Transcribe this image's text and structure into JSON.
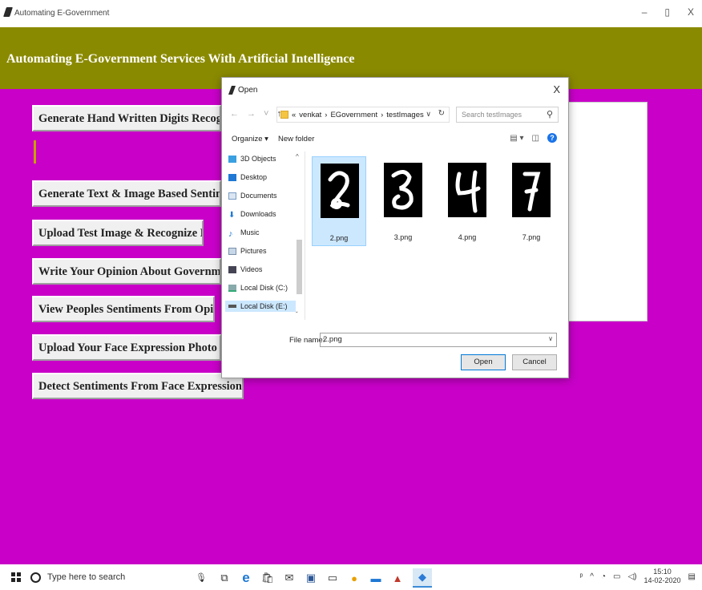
{
  "window": {
    "title": "Automating E-Government",
    "controls": {
      "minimize": "–",
      "maximize": "▯",
      "close": "X"
    }
  },
  "app": {
    "heading": "Automating E-Government Services With Artificial Intelligence",
    "buttons": [
      "Generate Hand Written Digits Recognition Deep Learning Model",
      "Generate Text & Image Based Sentiment Detection Deep Learning Model",
      "Upload Test Image & Recognize Digit",
      "Write Your Opinion About Government Policies",
      "View Peoples Sentiments From Opinions",
      "Upload Your Face Expression Photo About Government Policies",
      "Detect Sentiments From Face Expression Photo"
    ]
  },
  "dialog": {
    "title": "Open",
    "close": "X",
    "breadcrumb": [
      "«",
      "venkat",
      "›",
      "EGovernment",
      "›",
      "testImages"
    ],
    "search_placeholder": "Search testImages",
    "organize": "Organize ▾",
    "new_folder": "New folder",
    "nav_items": [
      "3D Objects",
      "Desktop",
      "Documents",
      "Downloads",
      "Music",
      "Pictures",
      "Videos",
      "Local Disk (C:)",
      "Local Disk (E:)"
    ],
    "files": [
      "2.png",
      "3.png",
      "4.png",
      "7.png"
    ],
    "file_name_label": "File name:",
    "file_name_value": "2.png",
    "open_label": "Open",
    "cancel_label": "Cancel"
  },
  "taskbar": {
    "search_placeholder": "Type here to search",
    "time": "15:10",
    "date": "14-02-2020"
  },
  "colors": {
    "app_bg": "#c800c8",
    "header_band": "#8a8a00",
    "accent_bar": "#c8a000",
    "selection": "#cce8ff"
  }
}
